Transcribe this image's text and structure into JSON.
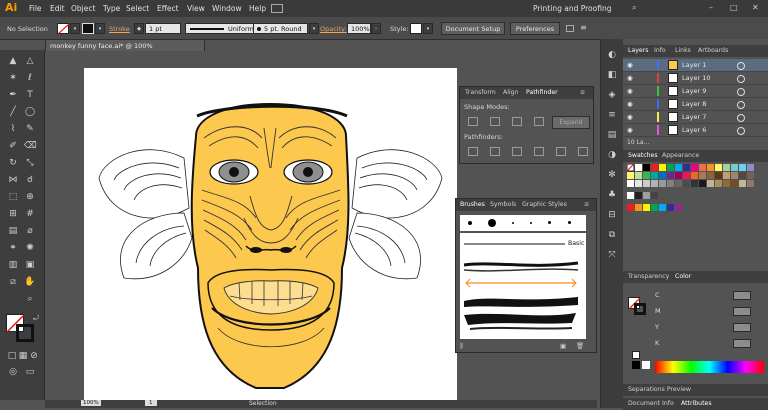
{
  "app": {
    "logo": "Ai",
    "workspace": "Printing and Proofing"
  },
  "menubar": {
    "items": [
      "File",
      "Edit",
      "Object",
      "Type",
      "Select",
      "Effect",
      "View",
      "Window",
      "Help"
    ]
  },
  "control_bar": {
    "selection_label": "No Selection",
    "stroke_label": "Stroke",
    "stroke_weight": "1 pt",
    "profile": "Uniform",
    "brush": "5 pt. Round",
    "opacity_label": "Opacity:",
    "opacity_value": "100%",
    "style_label": "Style:",
    "document_setup": "Document Setup",
    "preferences": "Preferences"
  },
  "document": {
    "tab_title": "monkey funny face.ai* @ 100% (CMYK/Preview)",
    "zoom": "100%",
    "page": "1",
    "status_tool": "Selection"
  },
  "pathfinder_panel": {
    "tabs": [
      "Transform",
      "Align",
      "Pathfinder"
    ],
    "shape_modes_label": "Shape Modes:",
    "pathfinders_label": "Pathfinders:",
    "expand_label": "Expand"
  },
  "brushes_panel": {
    "tabs": [
      "Brushes",
      "Symbols",
      "Graphic Styles"
    ],
    "basic_label": "Basic"
  },
  "layers_panel": {
    "tabs": [
      "Layers",
      "Info",
      "Links",
      "Artboards"
    ],
    "rows": [
      {
        "name": "Layer 1",
        "color": "#4b6bff",
        "selected": true
      },
      {
        "name": "Layer 10",
        "color": "#e23c3c",
        "selected": false
      },
      {
        "name": "Layer 9",
        "color": "#3bc43b",
        "selected": false
      },
      {
        "name": "Layer 8",
        "color": "#3d6cf0",
        "selected": false
      },
      {
        "name": "Layer 7",
        "color": "#f2ed4b",
        "selected": false
      },
      {
        "name": "Layer 6",
        "color": "#e257e2",
        "selected": false
      }
    ],
    "footer_count": "10 La..."
  },
  "swatches_panel": {
    "tabs": [
      "Swatches",
      "Appearance"
    ]
  },
  "color_panel": {
    "tabs": [
      "Transparency",
      "Color"
    ],
    "channels": [
      "C",
      "M",
      "Y",
      "K"
    ]
  },
  "bottom_panels": {
    "separations": "Separations Preview",
    "document_info": "Document Info",
    "attributes": "Attributes"
  },
  "colors": {
    "mask_fill": "#fcc84e",
    "accent_orange": "#ff8a1e"
  }
}
